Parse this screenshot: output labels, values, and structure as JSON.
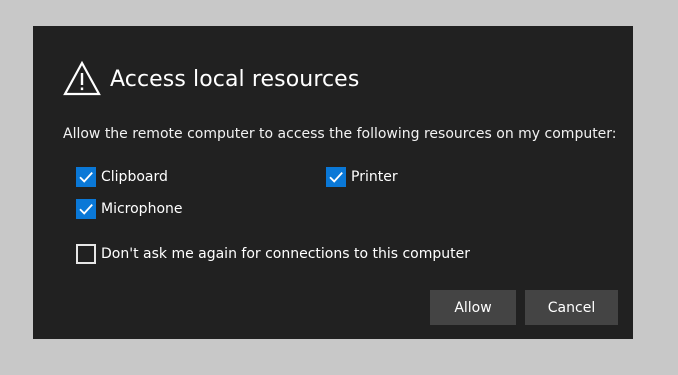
{
  "dialog": {
    "title": "Access local resources",
    "description": "Allow the remote computer to access the following resources on my computer:",
    "resources": [
      {
        "label": "Clipboard",
        "checked": true
      },
      {
        "label": "Printer",
        "checked": true
      },
      {
        "label": "Microphone",
        "checked": true
      }
    ],
    "dont_ask": {
      "label": "Don't ask me again for connections to this computer",
      "checked": false
    },
    "buttons": {
      "allow": "Allow",
      "cancel": "Cancel"
    }
  },
  "icons": {
    "title_icon": "warning-triangle-icon",
    "check_icon": "checkmark-icon"
  },
  "colors": {
    "page_background": "#c8c8c8",
    "dialog_background": "#212121",
    "checkbox_checked": "#0a78d7",
    "button_background": "#444444",
    "text": "#ffffff"
  }
}
